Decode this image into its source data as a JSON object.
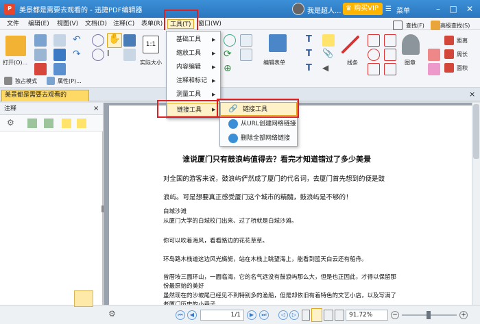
{
  "window": {
    "title": "美景都是需要去观看的 - 迅捷PDF编辑器",
    "user_name": "我是超人...",
    "vip_label": "购买VIP",
    "menu_label": "菜单"
  },
  "menubar": [
    "文件",
    "编辑(E)",
    "视图(V)",
    "文档(D)",
    "注释(C)",
    "表单(R)",
    "工具(T)",
    "窗口(W)"
  ],
  "toolbar": {
    "open_label": "打开(O)...",
    "actual_size_label": "实际大小",
    "edit_form_label": "编辑表单",
    "line_label": "线条",
    "stamp_label": "图章",
    "find_label": "查找(F)",
    "advanced_find_label": "高级查找(S)",
    "distance_label": "距离",
    "perimeter_label": "周长",
    "area_label": "面积",
    "exclusive_mode_label": "独占模式",
    "properties_label": "属性(P)..."
  },
  "doc_tab": {
    "name": "美景都是需要去观看的",
    "close": "×"
  },
  "left_panel": {
    "title": "注释"
  },
  "tools_menu": {
    "items": [
      "基础工具",
      "缩放工具",
      "内容编辑",
      "注释和标记",
      "测量工具",
      "链接工具"
    ]
  },
  "link_submenu": {
    "items": [
      "链接工具",
      "从URL创建网络链接",
      "删除全部网络链接"
    ]
  },
  "document": {
    "heading": "谁说厦门只有鼓浪屿值得去？看完才知道错过了多少美景",
    "para1_line1": "对全国的游客来说，鼓浪屿俨然成了厦门的代名词，去厦门首先想到的便是鼓",
    "para1_line2": "浪屿。可是想要真正感受厦门这个城市的精髓，鼓浪屿是不够的！",
    "sub1": "白城沙滩",
    "sub1_text": "从厦门大学的白城校门出来、过了桥就是白城沙滩。",
    "line2": "你可以吹着海风，看看路边的花花草草。",
    "line3": "环岛路木栈道这边风光旖旎，站在木栈上眺望海上，能看到篮天白云还有船舟。",
    "line4a": "曾厝垵三面环山，一面临海，它的名气远没有鼓浪屿那么大，但是也正因此，才得以保留那",
    "line4b": "份最原始的美好",
    "line5a": "虽然现在的沙坡尾已经见不到特别多的渔船，但是却依旧有着特色的文艺小店，以及写满了",
    "line5b": "老厦门历史的小巷子。"
  },
  "status": {
    "page_display": "1/1",
    "zoom": "91.72%"
  }
}
